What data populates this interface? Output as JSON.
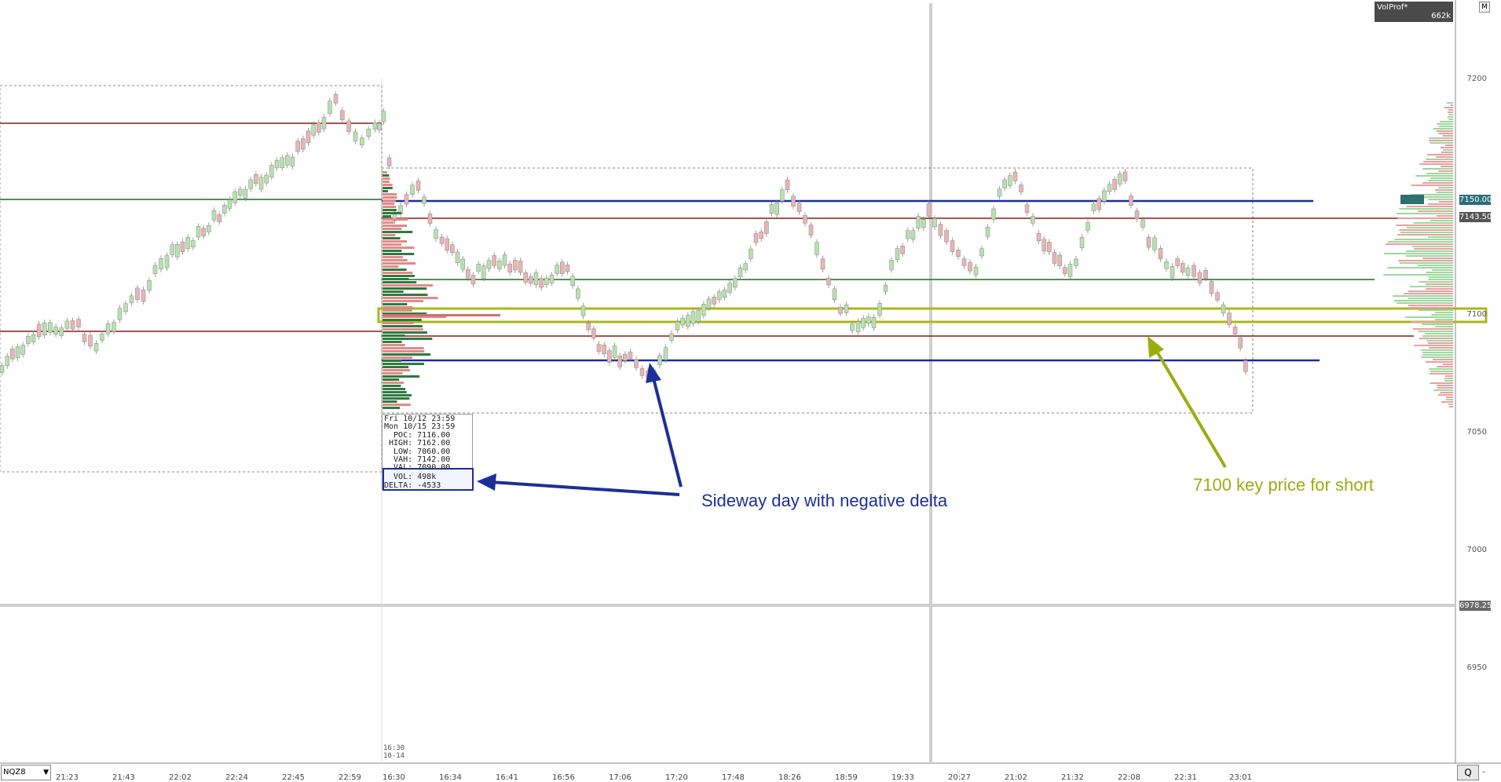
{
  "instrument": {
    "symbol": "NQZ8"
  },
  "indicator": {
    "name": "VolProf*",
    "volume": "662k",
    "maximize_label": "M"
  },
  "price_axis": {
    "ticks": [
      "7200",
      "7150",
      "7100",
      "7050",
      "7000",
      "6950"
    ],
    "badges": {
      "vah_like": "7150.00",
      "last": "7143.50",
      "cursor": "6978.25"
    }
  },
  "time_axis": {
    "labels": [
      "21:23",
      "21:43",
      "22:02",
      "22:24",
      "22:45",
      "22:59",
      "16:30",
      "16:34",
      "16:41",
      "16:56",
      "17:06",
      "17:20",
      "17:48",
      "18:26",
      "18:59",
      "19:33",
      "20:27",
      "21:02",
      "21:32",
      "22:08",
      "22:31",
      "23:01"
    ],
    "session_marker": {
      "time": "16:30",
      "date": "10-14"
    }
  },
  "info_box": {
    "line1": "Fri 10/12 23:59",
    "line2": "Mon 10/15 23:59",
    "poc": "  POC: 7116.00",
    "high": " HIGH: 7162.00",
    "low": "  LOW: 7060.00",
    "vah": "  VAH: 7142.00",
    "val": "  VAL: 7090.00",
    "vol": "  VOL: 498k",
    "delta": "DELTA: -4533"
  },
  "annotations": {
    "left": "Sideway day with negative delta",
    "right": "7100 key price for short"
  },
  "colors": {
    "up_candle": "#b8e0b0",
    "down_candle": "#e8b4b4",
    "red_level": "#8b1a1a",
    "green_level": "#1e6b1e",
    "blue_level": "#1a2f9a",
    "key_zone": "#a8b81a",
    "annotation_blue": "#1a2f9a",
    "annotation_olive": "#9aad12"
  },
  "controls": {
    "reset": "Q",
    "minus": "-"
  }
}
